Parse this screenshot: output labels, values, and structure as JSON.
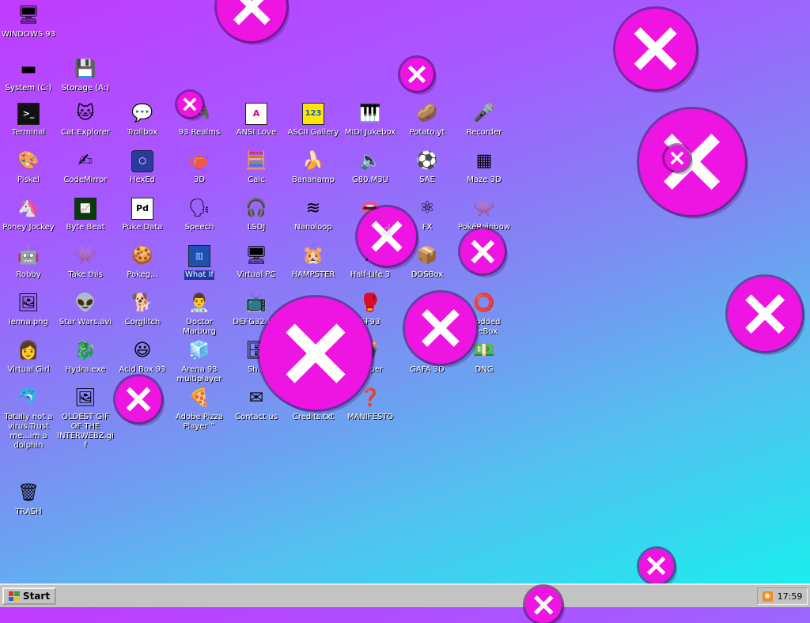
{
  "desktop": {
    "icons": {
      "windows93": {
        "label": "WINDOWS 93",
        "glyph": "🖥"
      },
      "system_c": {
        "label": "System (C:)",
        "glyph": "▬"
      },
      "storage_a": {
        "label": "Storage (A:)",
        "glyph": "💾"
      },
      "terminal": {
        "label": "Terminal",
        "glyph": ">_"
      },
      "cat_explorer": {
        "label": "Cat Explorer",
        "glyph": "🐱"
      },
      "trollbox": {
        "label": "Trollbox",
        "glyph": "💬"
      },
      "realms93": {
        "label": "93 Realms",
        "glyph": "🎮"
      },
      "ansi_love": {
        "label": "ANSI Love",
        "glyph": "A"
      },
      "ascii_gallery": {
        "label": "ASCII Gallery",
        "glyph": "123"
      },
      "midi_jukebox": {
        "label": "MIDI Jukebox",
        "glyph": "🎹"
      },
      "potato": {
        "label": "Potato.yt",
        "glyph": "🥔"
      },
      "recorder": {
        "label": "Recorder",
        "glyph": "🎤"
      },
      "piskel": {
        "label": "Piskel",
        "glyph": "🎨"
      },
      "codemirror": {
        "label": "CodeMirror",
        "glyph": "✍"
      },
      "hexed": {
        "label": "HexEd",
        "glyph": "⬡"
      },
      "three_d": {
        "label": "3D",
        "glyph": "🫖"
      },
      "calc": {
        "label": "Calc",
        "glyph": "🧮"
      },
      "bananamp": {
        "label": "Bananamp",
        "glyph": "🍌"
      },
      "g80m3u": {
        "label": "G80.M3U",
        "glyph": "🔈"
      },
      "sae": {
        "label": "SAE",
        "glyph": "⚽"
      },
      "maze3d": {
        "label": "Maze 3D",
        "glyph": "▦"
      },
      "poney": {
        "label": "Poney Jockey",
        "glyph": "🦄"
      },
      "byte_beat": {
        "label": "Byte Beat",
        "glyph": "📈"
      },
      "puke_data": {
        "label": "Puke Data",
        "glyph": "Pd"
      },
      "speech": {
        "label": "Speech",
        "glyph": "🗣"
      },
      "lsdj": {
        "label": "LSDJ",
        "glyph": "🎧"
      },
      "nanoloop": {
        "label": "Nanoloop",
        "glyph": "≋"
      },
      "glitch": {
        "label": "Gli...",
        "glyph": "👄"
      },
      "fx": {
        "label": "FX",
        "glyph": "⚛"
      },
      "pokerainbow": {
        "label": "PokéRainbow",
        "glyph": "👾"
      },
      "robby": {
        "label": "Robby",
        "glyph": "🤖"
      },
      "take_this": {
        "label": "Take this",
        "glyph": "👾"
      },
      "pokeblob": {
        "label": "Pokeg...",
        "glyph": "🍪"
      },
      "what_if": {
        "label": "What If",
        "glyph": "▥"
      },
      "virtual_pc": {
        "label": "Virtual PC",
        "glyph": "🖥"
      },
      "hampster": {
        "label": "HAMPSTER",
        "glyph": "🐹"
      },
      "half_life": {
        "label": "Half-Life 3",
        "glyph": "λ"
      },
      "dosbox": {
        "label": "DOSBox",
        "glyph": "📦"
      },
      "lenna": {
        "label": "lenna.png",
        "glyph": "🖼"
      },
      "star_wars": {
        "label": "Star Wars.avi",
        "glyph": "👽"
      },
      "corglitch": {
        "label": "Corglitch",
        "glyph": "🐕"
      },
      "doctor_marburg": {
        "label": "Doctor Marburg",
        "glyph": "👨‍⚕"
      },
      "defrag": {
        "label": "DEFG32.E...",
        "glyph": "📺"
      },
      "sf93": {
        "label": "SF93",
        "glyph": "🥊"
      },
      "codded_loopbox": {
        "label": "...odded ...eBox",
        "glyph": "⭕"
      },
      "virtual_girl": {
        "label": "Virtual Girl",
        "glyph": "👩"
      },
      "hydra": {
        "label": "Hydra.exe",
        "glyph": "🐉"
      },
      "acid_box": {
        "label": "Acid Box 93",
        "glyph": "😃"
      },
      "arena93": {
        "label": "Arena 93 multiplayer",
        "glyph": "🧊"
      },
      "sh": {
        "label": "Sh...",
        "glyph": "🗄"
      },
      "sweeper": {
        "label": "...eper",
        "glyph": "💣"
      },
      "gafa3d": {
        "label": "GAFA 3D",
        "glyph": "🎲"
      },
      "dng": {
        "label": "DNG",
        "glyph": "💵"
      },
      "dolphin": {
        "label": "Totally not a virus.Trust me...im a dolphin",
        "glyph": "🐬"
      },
      "oldest_gif": {
        "label": "OLDEST GIF OF THE INTERWEBZ.gif",
        "glyph": "🖼"
      },
      "adobe_pizza": {
        "label": "Adobe Pizza Player™",
        "glyph": "🍕"
      },
      "contact_us": {
        "label": "Contact us",
        "glyph": "✉"
      },
      "credits": {
        "label": "Credits.txt",
        "glyph": "📄"
      },
      "manifesto": {
        "label": "MANIFESTO",
        "glyph": "❓"
      },
      "trash": {
        "label": "TRASH",
        "glyph": "🗑"
      }
    }
  },
  "taskbar": {
    "start_label": "Start",
    "clock": "17:59",
    "tray_icon": "rss-feed-icon"
  },
  "colors": {
    "bubble": "#ee14e2",
    "taskbar": "#c3c3c3",
    "selection": "#1c3aa3",
    "gradient": [
      "#c13bff",
      "#a45bff",
      "#7d8cf2",
      "#52c2f0",
      "#14f2ee"
    ]
  }
}
